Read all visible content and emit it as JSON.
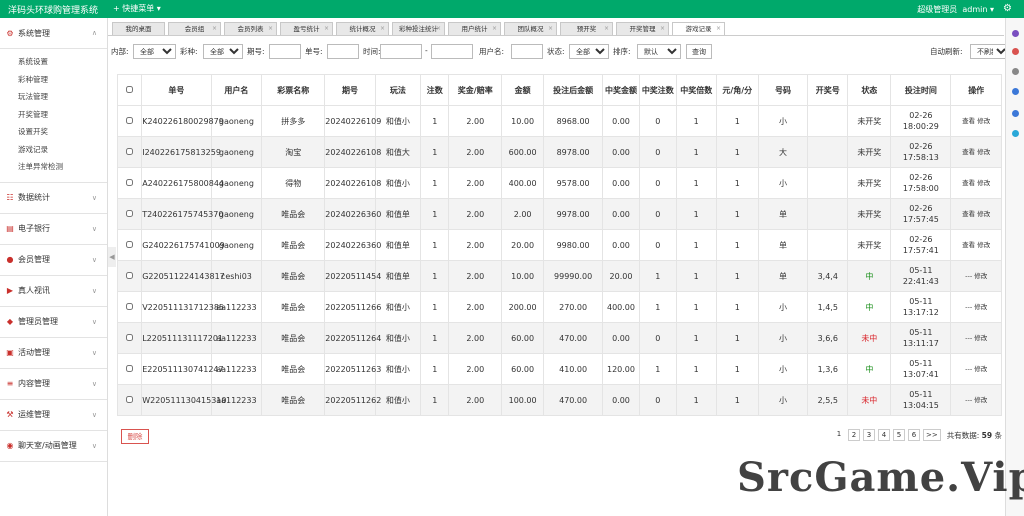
{
  "topbar": {
    "title": "洋码头环球购管理系统",
    "quick_menu": "+ 快捷菜单 ▾",
    "user_role": "超级管理员",
    "username": "admin ▾",
    "gear_icon": "gear-icon"
  },
  "sidebar": {
    "groups": [
      {
        "label": "系统管理",
        "icon": "gear-icon",
        "items": [
          "系统设置",
          "彩种管理",
          "玩法管理",
          "开奖管理",
          "设置开奖",
          "游戏记录",
          "注单异常检测"
        ]
      },
      {
        "label": "数据统计",
        "icon": "chart-icon"
      },
      {
        "label": "电子银行",
        "icon": "bank-icon"
      },
      {
        "label": "会员管理",
        "icon": "user-icon"
      },
      {
        "label": "真人视讯",
        "icon": "video-icon"
      },
      {
        "label": "管理员管理",
        "icon": "admin-icon"
      },
      {
        "label": "活动管理",
        "icon": "gift-icon"
      },
      {
        "label": "内容管理",
        "icon": "doc-icon"
      },
      {
        "label": "运维管理",
        "icon": "tool-icon"
      },
      {
        "label": "聊天室/动画管理",
        "icon": "chat-icon"
      }
    ]
  },
  "tabs": [
    "我的桌面",
    "会员组",
    "会员列表",
    "盈亏统计",
    "统计概况",
    "彩种投注统计",
    "用户统计",
    "团队概况",
    "预开奖",
    "开奖管理",
    "游戏记录"
  ],
  "filter": {
    "neibu_label": "内部:",
    "neibu_value": "全部",
    "caizhong_label": "彩种:",
    "caizhong_value": "全部",
    "qihao_label": "期号:",
    "danhao_label": "单号:",
    "time_label": "时间:",
    "time_sep": "-",
    "username_label": "用户名:",
    "status_label": "状态:",
    "status_value": "全部",
    "sort_label": "排序:",
    "sort_value": "默认",
    "query_btn": "查询",
    "auto_refresh_label": "自动刷新:",
    "auto_refresh_value": "不刷新"
  },
  "table": {
    "headers": [
      "单号",
      "用户名",
      "彩票名称",
      "期号",
      "玩法",
      "注数",
      "奖金/赔率",
      "金额",
      "投注后金额",
      "中奖金额",
      "中奖注数",
      "中奖倍数",
      "元/角/分",
      "号码",
      "开奖号",
      "状态",
      "投注时间",
      "操作"
    ],
    "rows": [
      [
        "K240226180029879",
        "gaoneng",
        "拼多多",
        "20240226109",
        "和值小",
        "1",
        "2.00",
        "10.00",
        "8968.00",
        "0.00",
        "0",
        "1",
        "1",
        "小",
        "",
        "未开奖",
        "02-26 18:00:29",
        "查看 修改"
      ],
      [
        "I240226175813259",
        "gaoneng",
        "淘宝",
        "20240226108",
        "和值大",
        "1",
        "2.00",
        "600.00",
        "8978.00",
        "0.00",
        "0",
        "1",
        "1",
        "大",
        "",
        "未开奖",
        "02-26 17:58:13",
        "查看 修改"
      ],
      [
        "A240226175800844",
        "gaoneng",
        "得物",
        "20240226108",
        "和值小",
        "1",
        "2.00",
        "400.00",
        "9578.00",
        "0.00",
        "0",
        "1",
        "1",
        "小",
        "",
        "未开奖",
        "02-26 17:58:00",
        "查看 修改"
      ],
      [
        "T240226175745370",
        "gaoneng",
        "唯品会",
        "20240226360",
        "和值单",
        "1",
        "2.00",
        "2.00",
        "9978.00",
        "0.00",
        "0",
        "1",
        "1",
        "单",
        "",
        "未开奖",
        "02-26 17:57:45",
        "查看 修改"
      ],
      [
        "G240226175741009",
        "gaoneng",
        "唯品会",
        "20240226360",
        "和值单",
        "1",
        "2.00",
        "20.00",
        "9980.00",
        "0.00",
        "0",
        "1",
        "1",
        "单",
        "",
        "未开奖",
        "02-26 17:57:41",
        "查看 修改"
      ],
      [
        "G220511224143817",
        "ceshi03",
        "唯品会",
        "20220511454",
        "和值单",
        "1",
        "2.00",
        "10.00",
        "99990.00",
        "20.00",
        "1",
        "1",
        "1",
        "单",
        "3,4,4",
        "中",
        "05-11 22:41:43",
        "--- 修改"
      ],
      [
        "V220511131712385",
        "aa112233",
        "唯品会",
        "20220511266",
        "和值小",
        "1",
        "2.00",
        "200.00",
        "270.00",
        "400.00",
        "1",
        "1",
        "1",
        "小",
        "1,4,5",
        "中",
        "05-11 13:17:12",
        "--- 修改"
      ],
      [
        "L220511131117201",
        "aa112233",
        "唯品会",
        "20220511264",
        "和值小",
        "1",
        "2.00",
        "60.00",
        "470.00",
        "0.00",
        "0",
        "1",
        "1",
        "小",
        "3,6,6",
        "未中",
        "05-11 13:11:17",
        "--- 修改"
      ],
      [
        "E220511130741247",
        "aa112233",
        "唯品会",
        "20220511263",
        "和值小",
        "1",
        "2.00",
        "60.00",
        "410.00",
        "120.00",
        "1",
        "1",
        "1",
        "小",
        "1,3,6",
        "中",
        "05-11 13:07:41",
        "--- 修改"
      ],
      [
        "W220511130415310",
        "aa112233",
        "唯品会",
        "20220511262",
        "和值小",
        "1",
        "2.00",
        "100.00",
        "470.00",
        "0.00",
        "0",
        "1",
        "1",
        "小",
        "2,5,5",
        "未中",
        "05-11 13:04:15",
        "--- 修改"
      ]
    ]
  },
  "footer": {
    "delete_btn": "删除",
    "pages": [
      "1",
      "2",
      "3",
      "4",
      "5",
      "6",
      ">>"
    ],
    "total_label": "共有数据:",
    "total_count": "59",
    "total_unit": "条"
  },
  "watermark": "SrcGame.Vip",
  "colors": {
    "brand": "#00a96b",
    "win": "#1a8f1a",
    "lose": "#d9262c",
    "menu_icon": "#c9302c"
  }
}
